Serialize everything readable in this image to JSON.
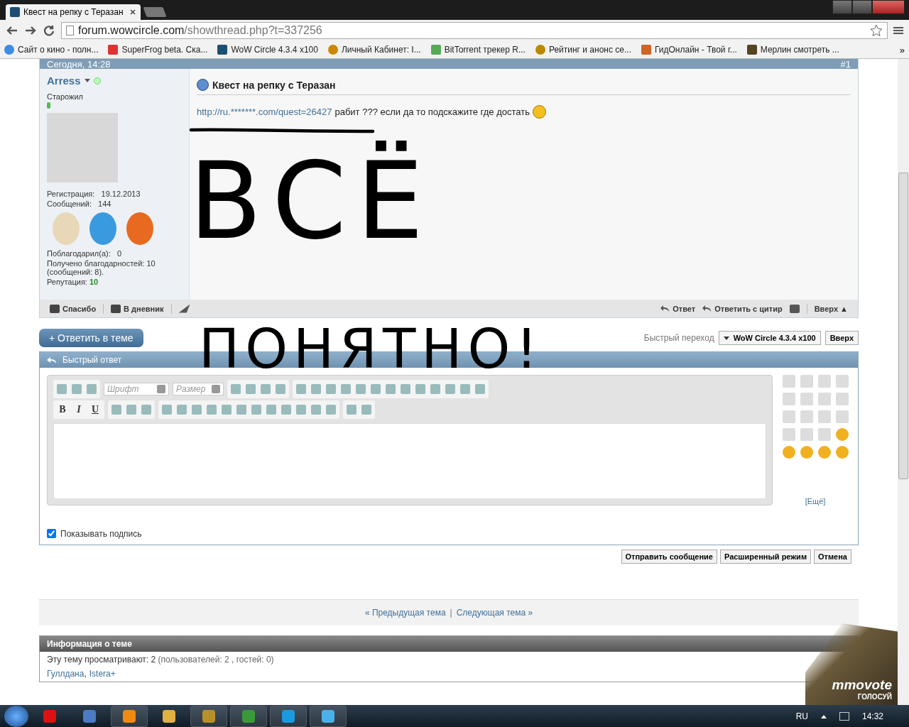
{
  "browser": {
    "tab_title": "Квест на репку с Теразан",
    "url_host": "forum.wowcircle.com",
    "url_path": "/showthread.php?t=337256",
    "bookmarks": [
      "Сайт о кино - полн...",
      "SuperFrog beta. Ска...",
      "WoW Circle 4.3.4 x100",
      "Личный Кабинет: I...",
      "BitTorrent трекер R...",
      "Рейтинг и анонс се...",
      "ГидОнлайн - Твой г...",
      "Мерлин смотреть ..."
    ],
    "more_bookmarks": "»"
  },
  "post": {
    "date": "Сегодня, 14:28",
    "number": "#1",
    "author": "Arress",
    "online": true,
    "rank": "Старожил",
    "stats": [
      {
        "label": "Регистрация:",
        "value": "19.12.2013"
      },
      {
        "label": "Сообщений:",
        "value": "144"
      }
    ],
    "thanked": "Поблагодарил(а):   0",
    "thanks_received": "Получено благодарностей: 10 (сообщений: 8).",
    "reputation_label": "Репутация:",
    "reputation": "10",
    "title": "Квест на репку с Теразан",
    "link": "http://ru.*******.com/quest=26427",
    "body": "рабит ??? если да то подскажите где достать",
    "scrawl": [
      "ВСЁ",
      "ПОНЯТНО!"
    ],
    "actions_left": [
      "Спасибо",
      "В дневник"
    ],
    "actions_right": [
      "Ответ",
      "Ответить с цитир",
      "Вверх ▲"
    ]
  },
  "reply_button": "+ Ответить в теме",
  "quick_nav": {
    "label": "Быстрый переход",
    "select": "WoW Circle 4.3.4 x100",
    "button": "Вверх"
  },
  "quick_reply": {
    "title": "Быстрый ответ",
    "font_placeholder": "Шрифт",
    "size_placeholder": "Размер",
    "format_buttons": [
      "B",
      "I",
      "U"
    ],
    "more_link": "[Ещё]",
    "show_signature": {
      "label": "Показывать подпись",
      "checked": true
    },
    "buttons": [
      "Отправить сообщение",
      "Расширенный режим",
      "Отмена"
    ]
  },
  "thread_nav": {
    "prev": "« Предыдущая тема",
    "separator": "|",
    "next": "Следующая тема »"
  },
  "thread_info": {
    "title": "Информация о теме",
    "viewers": "Эту тему просматривают: 2",
    "viewers_detail": "(пользователей: 2 , гостей: 0)",
    "users": [
      "Гуллдана",
      "Istera+"
    ],
    "user_separator": ","
  },
  "ad": {
    "logo": "mmovote",
    "caption": "ГОЛОСУЙ"
  },
  "taskbar": {
    "language": "RU",
    "time": "14:32"
  }
}
